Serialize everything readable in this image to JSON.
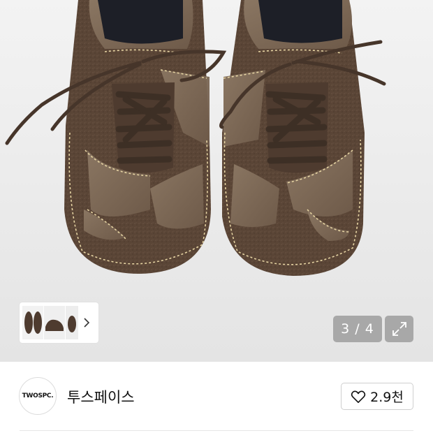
{
  "gallery": {
    "counter": "3 / 4",
    "thumbnails": [
      "shoes-top-view",
      "shoes-side-view"
    ],
    "icons": {
      "next": "chevron-right-icon",
      "expand": "expand-icon"
    }
  },
  "brand": {
    "logo_text": "TWOSPC.",
    "name": "투스페이스",
    "like_count": "2.9천",
    "like_icon": "heart-outline-icon"
  },
  "colors": {
    "suede": "#5b4637",
    "leather": "#7d6a59",
    "stitch": "#e8d7a8",
    "overlay": "#a8a8a8"
  }
}
